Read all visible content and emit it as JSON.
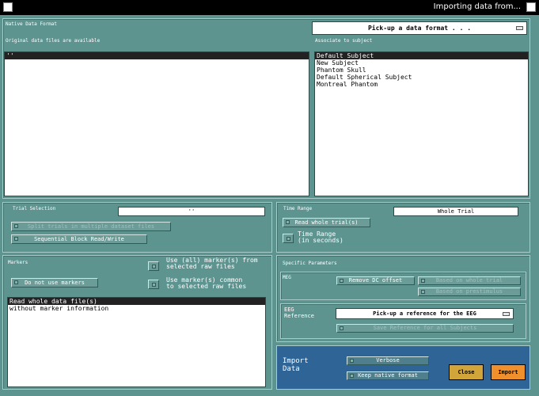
{
  "window": {
    "title": "Importing data from..."
  },
  "native": {
    "section_label": "Native Data Format",
    "files_label": "Original data files are available",
    "files": [
      "''"
    ],
    "format_dropdown": "Pick-up a data format . . .",
    "subject_label": "Associate to subject",
    "subjects": [
      "Default Subject",
      "New Subject",
      "Phantom Skull",
      "Default Spherical Subject",
      "Montreal Phantom"
    ]
  },
  "trial": {
    "section_label": "Trial Selection",
    "trial_field": "''",
    "split_button": "Split trials in multiple dataset files",
    "sequential_button": "Sequential Block Read/Write"
  },
  "time": {
    "section_label": "Time Range",
    "whole_field": "Whole Trial",
    "read_whole_button": "Read whole trial(s)",
    "time_range_label_1": "Time Range",
    "time_range_label_2": "(in  seconds)"
  },
  "markers": {
    "section_label": "Markers",
    "no_markers_button": "Do not use markers",
    "use_all_1": "Use (all) marker(s) from",
    "use_all_2": "selected raw files",
    "use_common_1": "Use marker(s) common",
    "use_common_2": "to selected raw files",
    "options": [
      "Read whole data file(s)",
      "without marker information"
    ]
  },
  "specific": {
    "section_label": "Specific Parameters",
    "meg_label": "MEG",
    "remove_dc": "Remove DC offset",
    "based_whole": "Based on whole trial",
    "based_prestim": "Based on prestimulus",
    "eeg_label_1": "EEG",
    "eeg_label_2": "Reference",
    "eeg_dropdown": "Pick-up a reference for the EEG",
    "save_ref": "Save Reference for all Subjects"
  },
  "import": {
    "label_1": "Import",
    "label_2": "Data",
    "verbose": "Verbose",
    "keep_native": "Keep native format",
    "close_button": "Close",
    "import_button": "Import"
  },
  "colors": {
    "background": "#5e9490",
    "import_panel": "#2e6496",
    "close": "#d2a53a",
    "import": "#f0902c"
  }
}
